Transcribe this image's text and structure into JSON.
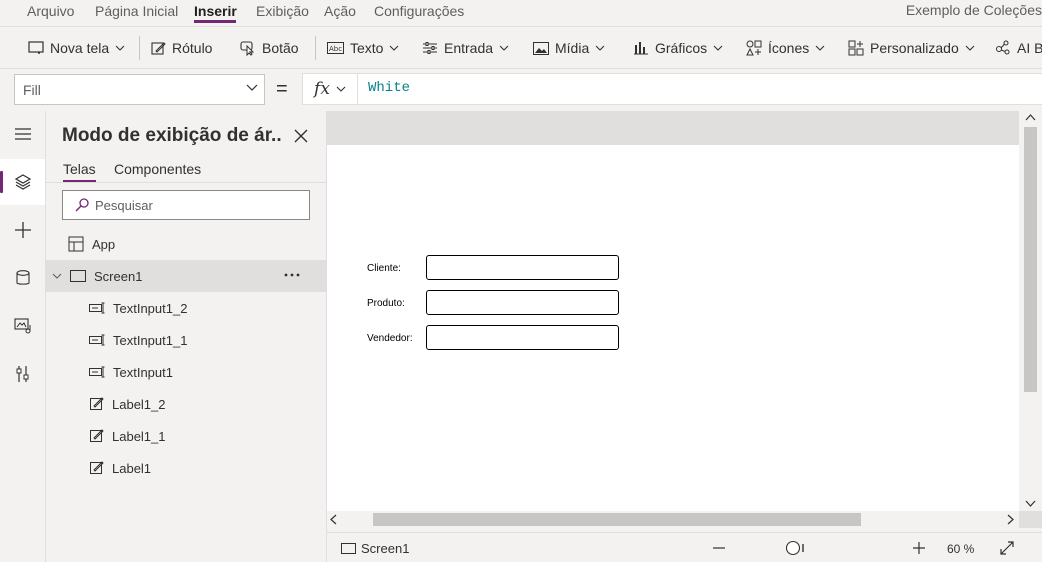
{
  "menu": {
    "items": [
      "Arquivo",
      "Página Inicial",
      "Inserir",
      "Exibição",
      "Ação",
      "Configurações"
    ],
    "active": "Inserir",
    "app_title": "Exemplo de Coleções"
  },
  "toolbar": {
    "nova_tela": "Nova tela",
    "rotulo": "Rótulo",
    "botao": "Botão",
    "texto": "Texto",
    "entrada": "Entrada",
    "midia": "Mídia",
    "graficos": "Gráficos",
    "icones": "Ícones",
    "personalizado": "Personalizado",
    "ai": "AI B"
  },
  "formula": {
    "property": "Fill",
    "equals": "=",
    "fx": "fx",
    "value": "White"
  },
  "rail": {
    "items": [
      "hamburger-icon",
      "layers-icon",
      "plus-icon",
      "database-icon",
      "media-icon",
      "tools-icon"
    ],
    "active": "layers-icon"
  },
  "tree": {
    "title": "Modo de exibição de ár...",
    "tabs": [
      "Telas",
      "Componentes"
    ],
    "active_tab": "Telas",
    "search_placeholder": "Pesquisar",
    "app_label": "App",
    "screen_label": "Screen1",
    "children": [
      {
        "label": "TextInput1_2",
        "icon": "text-input-icon"
      },
      {
        "label": "TextInput1_1",
        "icon": "text-input-icon"
      },
      {
        "label": "TextInput1",
        "icon": "text-input-icon"
      },
      {
        "label": "Label1_2",
        "icon": "label-edit-icon"
      },
      {
        "label": "Label1_1",
        "icon": "label-edit-icon"
      },
      {
        "label": "Label1",
        "icon": "label-edit-icon"
      }
    ]
  },
  "canvas": {
    "fields": [
      {
        "label": "Cliente:"
      },
      {
        "label": "Produto:"
      },
      {
        "label": "Vendedor:"
      }
    ]
  },
  "status": {
    "screen": "Screen1",
    "zoom": "60 %"
  },
  "colors": {
    "accent": "#742774",
    "formula_text": "#05828c"
  }
}
